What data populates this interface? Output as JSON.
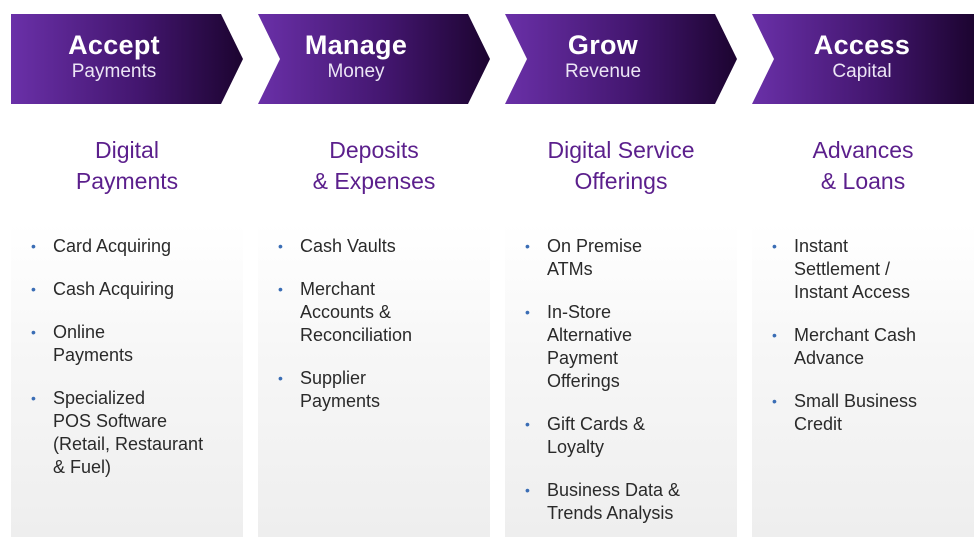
{
  "stages": [
    {
      "title": "Accept",
      "subtitle": "Payments",
      "heading_line1": "Digital",
      "heading_line2": "Payments",
      "items": [
        "Card Acquiring",
        "Cash Acquiring",
        "Online\nPayments",
        "Specialized\nPOS Software\n(Retail, Restaurant\n& Fuel)"
      ]
    },
    {
      "title": "Manage",
      "subtitle": "Money",
      "heading_line1": "Deposits",
      "heading_line2": "& Expenses",
      "items": [
        "Cash Vaults",
        "Merchant\nAccounts &\nReconciliation",
        "Supplier\nPayments"
      ]
    },
    {
      "title": "Grow",
      "subtitle": "Revenue",
      "heading_line1": "Digital Service",
      "heading_line2": "Offerings",
      "items": [
        "On Premise\nATMs",
        "In-Store\nAlternative\nPayment\nOfferings",
        "Gift Cards &\nLoyalty",
        "Business Data &\nTrends Analysis"
      ]
    },
    {
      "title": "Access",
      "subtitle": "Capital",
      "heading_line1": "Advances",
      "heading_line2": "& Loans",
      "items": [
        "Instant\nSettlement /\nInstant Access",
        "Merchant Cash\nAdvance",
        "Small Business\nCredit"
      ]
    }
  ],
  "colors": {
    "chevron_start": "#5e2a96",
    "chevron_end": "#1f0530",
    "heading": "#5b1f8c",
    "bullet": "#3a6db5"
  }
}
